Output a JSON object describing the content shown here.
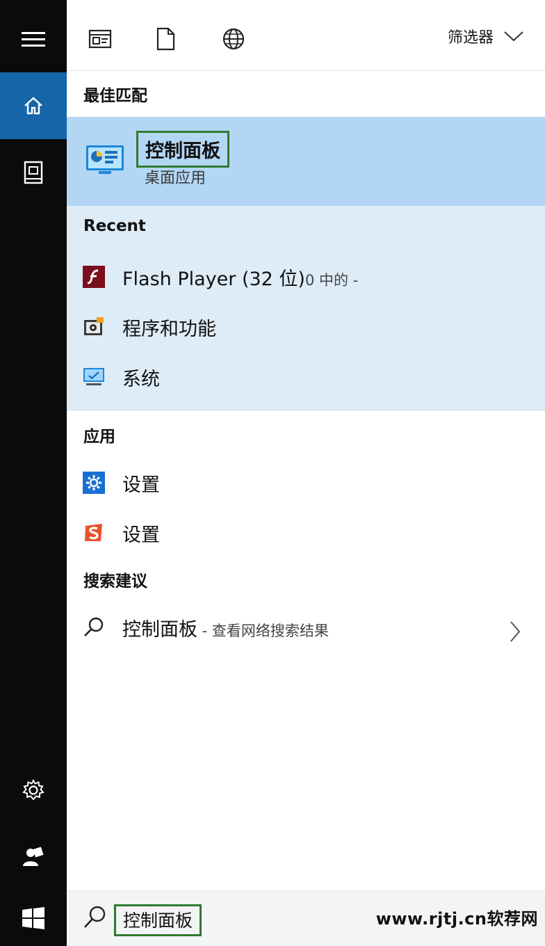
{
  "rail": {
    "icons": [
      "hamburger-icon",
      "home-icon",
      "document-icon",
      "gear-icon",
      "user-icon",
      "windows-logo-icon"
    ],
    "active": "home-icon",
    "accent_color": "#1565a8",
    "background": "#0b0b0b"
  },
  "toolbar": {
    "icons": [
      "apps-icon",
      "documents-icon",
      "web-icon"
    ],
    "filter_label": "筛选器"
  },
  "best_match": {
    "heading": "最佳匹配",
    "title": "控制面板",
    "subtitle": "桌面应用",
    "icon": "control-panel-icon",
    "highlight_color": "#b3d6f4"
  },
  "recent": {
    "heading": "Recent",
    "items": [
      {
        "label": "Flash Player (32 位)",
        "suffix": "0 中的 -",
        "icon": "flash-icon"
      },
      {
        "label": "程序和功能",
        "suffix": "",
        "icon": "programs-icon"
      },
      {
        "label": "系统",
        "suffix": "",
        "icon": "system-monitor-icon"
      }
    ]
  },
  "apps": {
    "heading": "应用",
    "items": [
      {
        "label": "设置",
        "icon": "settings-gear-icon"
      },
      {
        "label": "设置",
        "icon": "sogou-s-icon"
      }
    ]
  },
  "suggestions": {
    "heading": "搜索建议",
    "items": [
      {
        "label": "控制面板",
        "suffix": " - 查看网络搜索结果",
        "icon": "search-icon"
      }
    ]
  },
  "search_box": {
    "value": "控制面板"
  },
  "watermark": "www.rjtj.cn软荐网"
}
